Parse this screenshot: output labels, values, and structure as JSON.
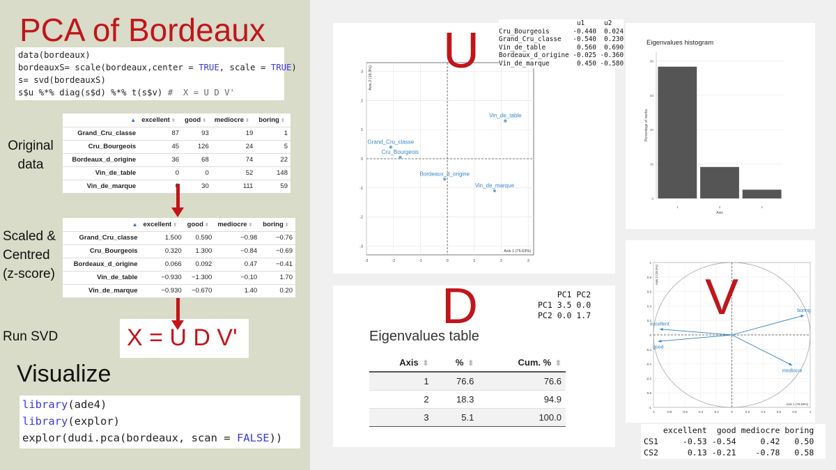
{
  "title": "PCA of Bordeaux",
  "code1": {
    "line1": "data(bordeaux)",
    "line2_pre": "bordeauxS= scale(bordeaux,center = ",
    "line2_kw1": "TRUE",
    "line2_mid": ", scale = ",
    "line2_kw2": "TRUE",
    "line2_post": ")",
    "line3": "s= svd(bordeauxS)",
    "line4_code": "s$u %*% diag(s$d) %*% t(s$v) ",
    "line4_comment": "#  X = U D V'"
  },
  "labels": {
    "original_1": "Original",
    "original_2": "data",
    "scaled_1": "Scaled &",
    "scaled_2": "Centred",
    "scaled_3": "(z-score)",
    "run_svd": "Run SVD",
    "visualize": "Visualize"
  },
  "original_table": {
    "sort_icon": "▲",
    "headers": [
      "excellent",
      "good",
      "mediocre",
      "boring"
    ],
    "rows": [
      {
        "name": "Grand_Cru_classe",
        "values": [
          "87",
          "93",
          "19",
          "1"
        ]
      },
      {
        "name": "Cru_Bourgeois",
        "values": [
          "45",
          "126",
          "24",
          "5"
        ]
      },
      {
        "name": "Bordeaux_d_origine",
        "values": [
          "36",
          "68",
          "74",
          "22"
        ]
      },
      {
        "name": "Vin_de_table",
        "values": [
          "0",
          "0",
          "52",
          "148"
        ]
      },
      {
        "name": "Vin_de_marque",
        "values": [
          "0",
          "30",
          "111",
          "59"
        ]
      }
    ]
  },
  "scaled_table": {
    "sort_icon": "▲",
    "headers": [
      "excellent",
      "good",
      "mediocre",
      "boring"
    ],
    "rows": [
      {
        "name": "Grand_Cru_classe",
        "values": [
          "1.500",
          "0.590",
          "−0.98",
          "−0.76"
        ]
      },
      {
        "name": "Cru_Bourgeois",
        "values": [
          "0.320",
          "1.300",
          "−0.84",
          "−0.69"
        ]
      },
      {
        "name": "Bordeaux_d_origine",
        "values": [
          "0.066",
          "0.092",
          "0.47",
          "−0.41"
        ]
      },
      {
        "name": "Vin_de_table",
        "values": [
          "−0.930",
          "−1.300",
          "−0.10",
          "1.70"
        ]
      },
      {
        "name": "Vin_de_marque",
        "values": [
          "−0.930",
          "−0.670",
          "1.40",
          "0.20"
        ]
      }
    ]
  },
  "svd_formula": "X = U D V'",
  "code2": {
    "line1_kw": "library",
    "line1_post": "(ade4)",
    "line2_kw": "library",
    "line2_post": "(explor)",
    "line3_pre": "explor(dudi.pca(bordeaux, scan = ",
    "line3_kw": "FALSE",
    "line3_post": "))"
  },
  "u_panel": {
    "letter": "U",
    "matrix": "                    u1     u2\nCru_Bourgeois      -0.440  0.024\nGrand_Cru_classe   -0.540  0.230\nVin_de_table        0.560  0.690\nBordeaux_d_origine -0.025 -0.360\nVin_de_marque       0.450 -0.580",
    "row_dots": [
      "-",
      "-",
      "-",
      "-",
      "-"
    ]
  },
  "chart_data": [
    {
      "type": "scatter",
      "xlabel": "Axis 1 (76.63%)",
      "ylabel": "Axis 2 (18.3%)",
      "xlim": [
        -3,
        3.2
      ],
      "ylim": [
        -3.3,
        3.3
      ],
      "xticks": [
        "-3",
        "-2",
        "-1",
        "0",
        "1",
        "2",
        "3"
      ],
      "yticks": [
        "3",
        "2",
        "1",
        "0",
        "-1",
        "-2",
        "-3"
      ],
      "points": [
        {
          "label": "Grand_Cru_classe",
          "x": -2.1,
          "y": 0.4
        },
        {
          "label": "Cru_Bourgeois",
          "x": -1.75,
          "y": 0.05
        },
        {
          "label": "Vin_de_table",
          "x": 2.15,
          "y": 1.3
        },
        {
          "label": "Bordeaux_d_origine",
          "x": -0.1,
          "y": -0.7
        },
        {
          "label": "Vin_de_marque",
          "x": 1.75,
          "y": -1.1
        }
      ],
      "grid": true,
      "point_color": "#6fa8d6"
    },
    {
      "type": "bar",
      "title": "Eigenvalues histogram",
      "xlabel": "Axis",
      "ylabel": "Percentage of inertia",
      "categories": [
        "1",
        "2",
        "3"
      ],
      "values": [
        76.6,
        18.3,
        5.1
      ],
      "ylim": [
        0,
        85
      ],
      "yticks": [
        "80",
        "60",
        "40",
        "20",
        "0"
      ],
      "bar_color": "#555555"
    },
    {
      "type": "table",
      "title": "Eigenvalues table",
      "headers": [
        "Axis",
        "%",
        "Cum. %"
      ],
      "rows": [
        [
          "1",
          "76.6",
          "76.6"
        ],
        [
          "2",
          "18.3",
          "94.9"
        ],
        [
          "3",
          "5.1",
          "100.0"
        ]
      ]
    },
    {
      "type": "scatter",
      "subtype": "correlation-circle",
      "xlabel": "Axis 1 (76.63%)",
      "ylabel": "Axis 2 (18.3%)",
      "xlim": [
        -1,
        1
      ],
      "ylim": [
        -1,
        1
      ],
      "xticks": [
        "-1",
        "-0.8",
        "-0.6",
        "-0.4",
        "-0.2",
        "0",
        "0.2",
        "0.4",
        "0.6",
        "0.8",
        "1"
      ],
      "yticks": [
        "1",
        "0.8",
        "0.6",
        "0.4",
        "0.2",
        "0",
        "-0.2",
        "-0.4",
        "-0.6",
        "-0.8",
        "-1"
      ],
      "vectors": [
        {
          "label": "boring",
          "x": 0.92,
          "y": 0.27
        },
        {
          "label": "excellent",
          "x": -0.92,
          "y": 0.08
        },
        {
          "label": "good",
          "x": -0.94,
          "y": -0.09
        },
        {
          "label": "mediocre",
          "x": 0.77,
          "y": -0.42
        }
      ],
      "arrow_color": "#2e7fbf"
    }
  ],
  "d_panel": {
    "letter": "D",
    "matrix": "    PC1 PC2\nPC1 3.5 0.0\nPC2 0.0 1.7",
    "sort_icon": "⬍"
  },
  "v_panel": {
    "letter": "V",
    "matrix": "    excellent  good mediocre boring\nCS1     -0.53 -0.54     0.42   0.50\nCS2      0.13 -0.21    -0.78   0.58"
  }
}
